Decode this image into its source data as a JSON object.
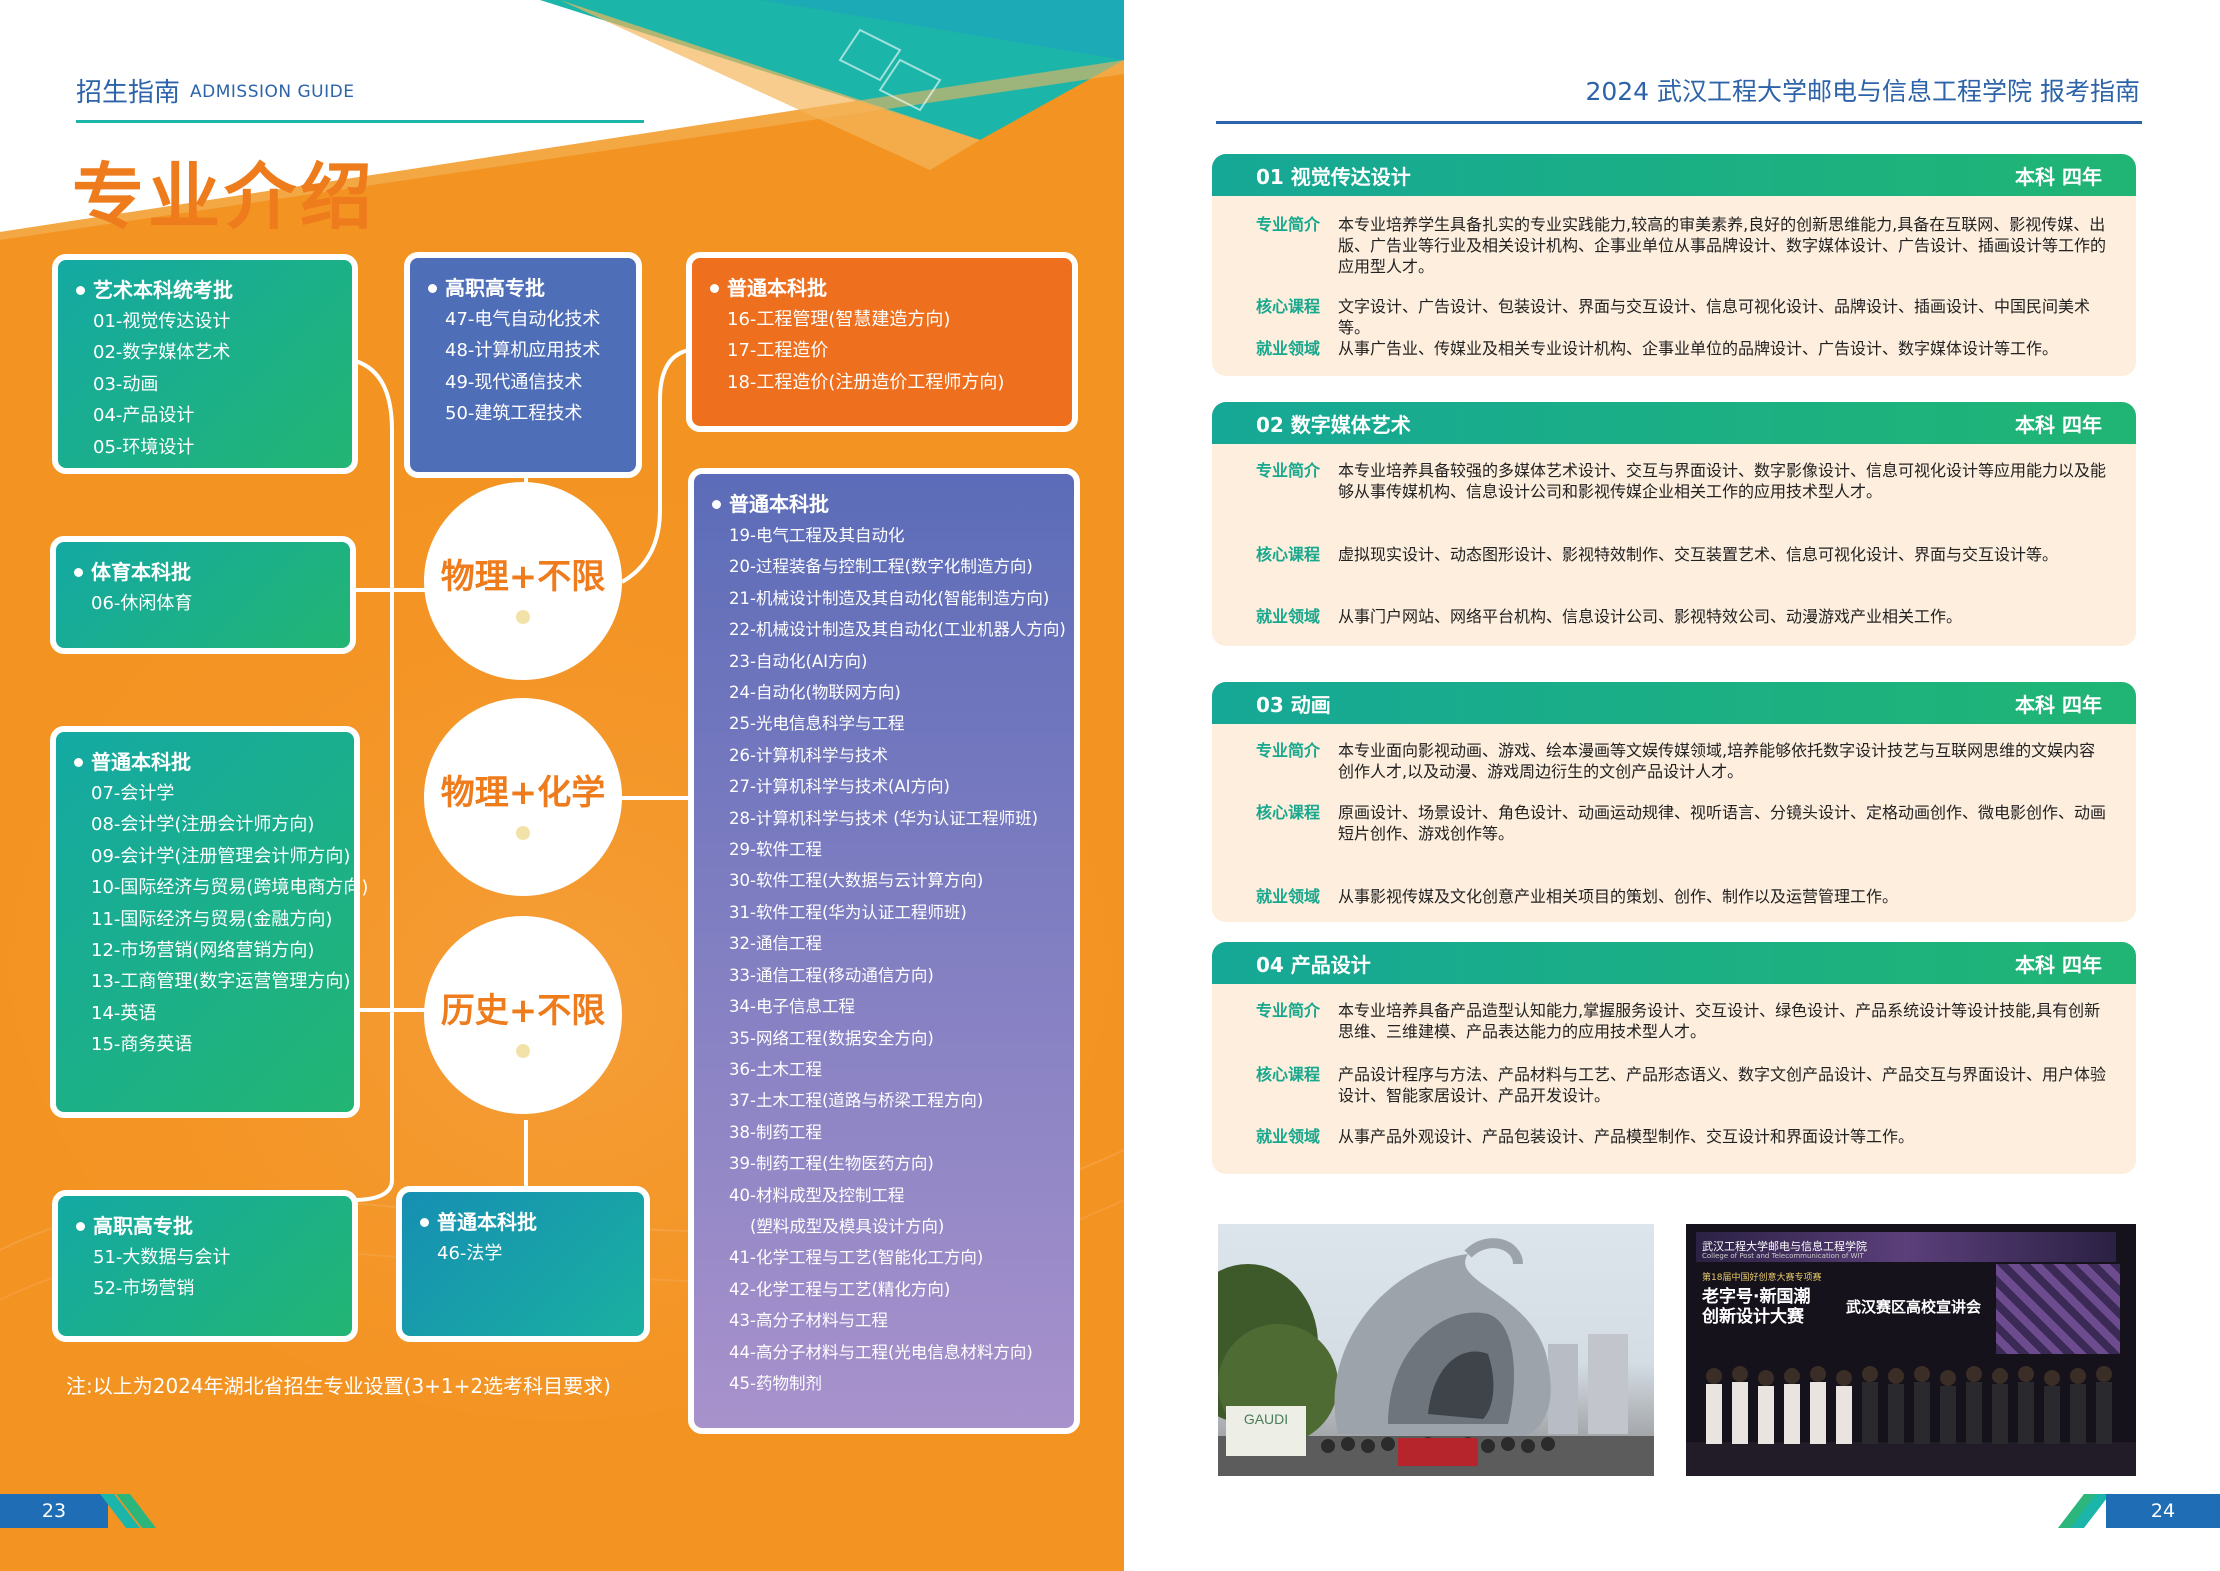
{
  "left_header": {
    "cn": "招生指南",
    "en": "ADMISSION GUIDE",
    "title": "专业介绍"
  },
  "right_header": {
    "title": "2024  武汉工程大学邮电与信息工程学院  报考指南"
  },
  "groups": {
    "art": {
      "title": "艺术本科统考批",
      "items": [
        "01-视觉传达设计",
        "02-数字媒体艺术",
        "03-动画",
        "04-产品设计",
        "05-环境设计"
      ]
    },
    "sport": {
      "title": "体育本科批",
      "items": [
        "06-休闲体育"
      ]
    },
    "hist_ben": {
      "title": "普通本科批",
      "items": [
        "07-会计学",
        "08-会计学(注册会计师方向)",
        "09-会计学(注册管理会计师方向)",
        "10-国际经济与贸易(跨境电商方向)",
        "11-国际经济与贸易(金融方向)",
        "12-市场营销(网络营销方向)",
        "13-工商管理(数字运营管理方向)",
        "14-英语",
        "15-商务英语"
      ]
    },
    "hist_zhuan": {
      "title": "高职高专批",
      "items": [
        "51-大数据与会计",
        "52-市场营销"
      ]
    },
    "hist_ben2": {
      "title": "普通本科批",
      "items": [
        "46-法学"
      ]
    },
    "phys_zhuan": {
      "title": "高职高专批",
      "items": [
        "47-电气自动化技术",
        "48-计算机应用技术",
        "49-现代通信技术",
        "50-建筑工程技术"
      ]
    },
    "phys_ben": {
      "title": "普通本科批",
      "items": [
        "16-工程管理(智慧建造方向)",
        "17-工程造价",
        "18-工程造价(注册造价工程师方向)"
      ]
    },
    "chem_ben": {
      "title": "普通本科批",
      "items": [
        "19-电气工程及其自动化",
        "20-过程装备与控制工程(数字化制造方向)",
        "21-机械设计制造及其自动化(智能制造方向)",
        "22-机械设计制造及其自动化(工业机器人方向)",
        "23-自动化(AI方向)",
        "24-自动化(物联网方向)",
        "25-光电信息科学与工程",
        "26-计算机科学与技术",
        "27-计算机科学与技术(AI方向)",
        "28-计算机科学与技术 (华为认证工程师班)",
        "29-软件工程",
        "30-软件工程(大数据与云计算方向)",
        "31-软件工程(华为认证工程师班)",
        "32-通信工程",
        "33-通信工程(移动通信方向)",
        "34-电子信息工程",
        "35-网络工程(数据安全方向)",
        "36-土木工程",
        "37-土木工程(道路与桥梁工程方向)",
        "38-制药工程",
        "39-制药工程(生物医药方向)",
        "40-材料成型及控制工程",
        "    (塑料成型及模具设计方向)",
        "41-化学工程与工艺(智能化工方向)",
        "42-化学工程与工艺(精化方向)",
        "43-高分子材料与工程",
        "44-高分子材料与工程(光电信息材料方向)",
        "45-药物制剂"
      ]
    }
  },
  "circles": {
    "c1": "物理+不限",
    "c2": "物理+化学",
    "c3": "历史+不限"
  },
  "note": "注:以上为2024年湖北省招生专业设置(3+1+2选考科目要求)",
  "page_left": "23",
  "page_right": "24",
  "labels": {
    "intro": "专业简介",
    "course": "核心课程",
    "career": "就业领域"
  },
  "majors": [
    {
      "name": "01  视觉传达设计",
      "meta": "本科   四年",
      "intro": "本专业培养学生具备扎实的专业实践能力,较高的审美素养,良好的创新思维能力,具备在互联网、影视传媒、出版、广告业等行业及相关设计机构、企事业单位从事品牌设计、数字媒体设计、广告设计、插画设计等工作的应用型人才。",
      "course": "文字设计、广告设计、包装设计、界面与交互设计、信息可视化设计、品牌设计、插画设计、中国民间美术等。",
      "career": "从事广告业、传媒业及相关专业设计机构、企事业单位的品牌设计、广告设计、数字媒体设计等工作。"
    },
    {
      "name": "02  数字媒体艺术",
      "meta": "本科   四年",
      "intro": "本专业培养具备较强的多媒体艺术设计、交互与界面设计、数字影像设计、信息可视化设计等应用能力以及能够从事传媒机构、信息设计公司和影视传媒企业相关工作的应用技术型人才。",
      "course": "虚拟现实设计、动态图形设计、影视特效制作、交互装置艺术、信息可视化设计、界面与交互设计等。",
      "career": "从事门户网站、网络平台机构、信息设计公司、影视特效公司、动漫游戏产业相关工作。"
    },
    {
      "name": "03  动画",
      "meta": "本科   四年",
      "intro": "本专业面向影视动画、游戏、绘本漫画等文娱传媒领域,培养能够依托数字设计技艺与互联网思维的文娱内容创作人才,以及动漫、游戏周边衍生的文创产品设计人才。",
      "course": "原画设计、场景设计、角色设计、动画运动规律、视听语言、分镜头设计、定格动画创作、微电影创作、动画短片创作、游戏创作等。",
      "career": "从事影视传媒及文化创意产业相关项目的策划、创作、制作以及运营管理工作。"
    },
    {
      "name": "04  产品设计",
      "meta": "本科   四年",
      "intro": "本专业培养具备产品造型认知能力,掌握服务设计、交互设计、绿色设计、产品系统设计等设计技能,具有创新思维、三维建模、产品表达能力的应用技术型人才。",
      "course": "产品设计程序与方法、产品材料与工艺、产品形态语义、数字文创产品设计、产品交互与界面设计、用户体验设计、智能家居设计、产品开发设计。",
      "career": "从事产品外观设计、产品包装设计、产品模型制作、交互设计和界面设计等工作。"
    }
  ],
  "photo2_text": {
    "l1": "第18届中国好创意大赛专项赛",
    "l2": "老字号·新国潮",
    "l3": "创新设计大赛",
    "l4": "武汉赛区高校宣讲会",
    "org": "武汉工程大学邮电与信息工程学院",
    "org_en": "College of Post and Telecommunication of WIT"
  },
  "photo1_text": {
    "sign": "GAUDI"
  },
  "colors": {
    "orange": "#F39322",
    "green": "#1CB5A9",
    "blue": "#2D63A8",
    "purple": "#7A7DC0",
    "cream": "#FDEEDD"
  }
}
